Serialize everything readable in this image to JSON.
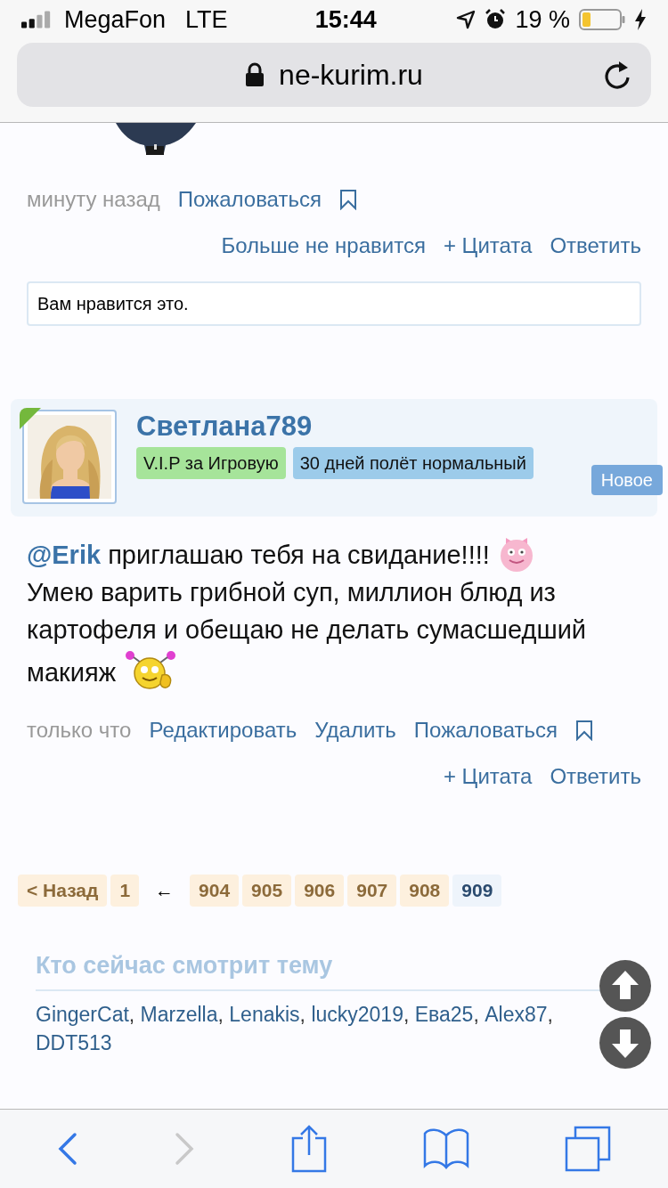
{
  "status_bar": {
    "carrier": "MegaFon",
    "network": "LTE",
    "time": "15:44",
    "battery": "19 %",
    "charging": true
  },
  "address_bar": {
    "url": "ne-kurim.ru"
  },
  "previous_post": {
    "time": "минуту назад",
    "report_link": "Пожаловаться",
    "actions": [
      "Больше не нравится",
      "+ Цитата",
      "Ответить"
    ],
    "like_notice": "Вам нравится это."
  },
  "post": {
    "author": "Светлана789",
    "online": true,
    "badges": [
      {
        "text": "V.I.P за Игровую",
        "color": "#a6e49a"
      },
      {
        "text": "30 дней полёт нормальный",
        "color": "#9ccbea"
      }
    ],
    "new_label": "Новое",
    "body": [
      {
        "kind": "mention",
        "text": "@Erik"
      },
      {
        "kind": "text",
        "text": "приглашаю тебя на свидание!!!!"
      },
      {
        "kind": "emoticon_pink"
      },
      {
        "kind": "break"
      },
      {
        "kind": "text",
        "text": "Умею варить грибной суп, миллион блюд из картофеля и обещаю не делать сумасшедший"
      },
      {
        "kind": "break"
      },
      {
        "kind": "text",
        "text": "макияж"
      },
      {
        "kind": "emoticon_yellow"
      }
    ],
    "time": "только что",
    "links": [
      "Редактировать",
      "Удалить",
      "Пожаловаться"
    ],
    "actions": [
      "+ Цитата",
      "Ответить"
    ]
  },
  "pagination": [
    {
      "label": "< Назад",
      "selected": false
    },
    {
      "label": "1",
      "selected": false
    },
    {
      "label": "←",
      "kind": "separator"
    },
    {
      "label": "904",
      "selected": false
    },
    {
      "label": "905",
      "selected": false
    },
    {
      "label": "906",
      "selected": false
    },
    {
      "label": "907",
      "selected": false
    },
    {
      "label": "908",
      "selected": false
    },
    {
      "label": "909",
      "selected": true
    }
  ],
  "viewers": {
    "title": "Кто сейчас смотрит тему",
    "separator": ",",
    "users": [
      "GingerCat",
      "Marzella",
      "Lenakis",
      "lucky2019",
      "Ева25",
      "Alex87",
      "DDT513"
    ]
  },
  "toolbar": {
    "back_enabled": true,
    "forward_enabled": false
  }
}
